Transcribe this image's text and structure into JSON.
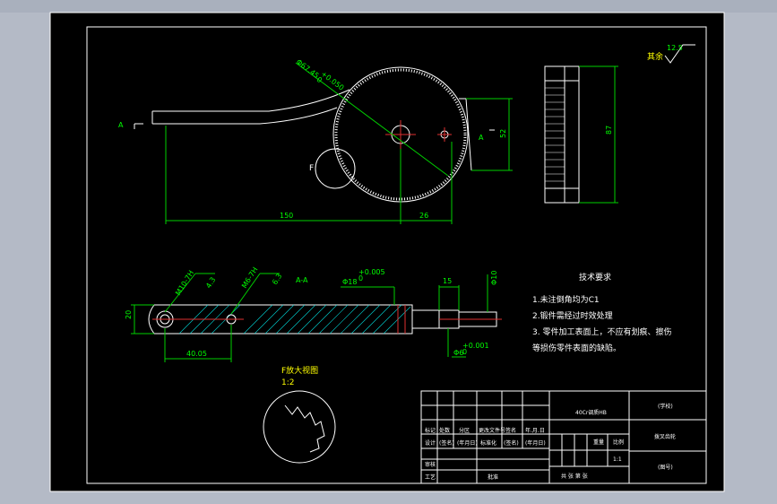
{
  "main_view": {
    "section_mark_left": "A",
    "section_mark_right": "A",
    "detail_mark": "F",
    "dim_dia": "Φ67.45",
    "dim_dia_tol_top": "+0.050",
    "dim_dia_tol_bot": "0",
    "dim_150": "150",
    "dim_26": "26",
    "dim_52": "52"
  },
  "side_view": {
    "roughness_note": "其余",
    "roughness_value": "12.5",
    "dim_87": "87"
  },
  "section_view": {
    "title": "A-A",
    "thread1": "M10-7H",
    "thread1_depth": "4.3",
    "thread2": "M6-7H",
    "thread2_depth": "6.3",
    "dim_18": "Φ18",
    "dim_18_tol_top": "+0.005",
    "dim_18_tol_bot": "0",
    "dim_15": "15",
    "dim_10": "Φ10",
    "dim_20": "20",
    "dim_40": "40.05",
    "dim_6": "Φ6",
    "dim_6_tol_top": "+0.001",
    "dim_6_tol_bot": "0"
  },
  "detail_view": {
    "title": "F放大视图",
    "scale": "1:2"
  },
  "tech_req": {
    "title": "技术要求",
    "line1": "1.未注倒角均为C1",
    "line2": "2.锻件需经过时效处理",
    "line3": "3. 零件加工表面上，不应有划痕、擦伤",
    "line4": "等损伤零件表面的缺陷。"
  },
  "title_block": {
    "material": "40Cr调质HB",
    "school": "(学校)",
    "part_name": "拨叉齿轮",
    "drawing_no": "(图号)",
    "scale_label": "比例",
    "scale_value": "1:1",
    "weight_label": "重量",
    "stage_label": "阶段标记",
    "sheet_info": "共 张 第 张",
    "r_mark": "标记",
    "r_count": "处数",
    "r_zone": "分区",
    "r_doc": "更改文件号",
    "r_sign": "签名",
    "r_date": "年.月.日",
    "r_design": "设计",
    "r_signname": "(签名)",
    "r_ymd": "(年月日)",
    "r_std": "标准化",
    "r_signname2": "(签名)",
    "r_ymd2": "(年月日)",
    "r_review": "审核",
    "r_process": "工艺",
    "r_approve": "批准"
  }
}
